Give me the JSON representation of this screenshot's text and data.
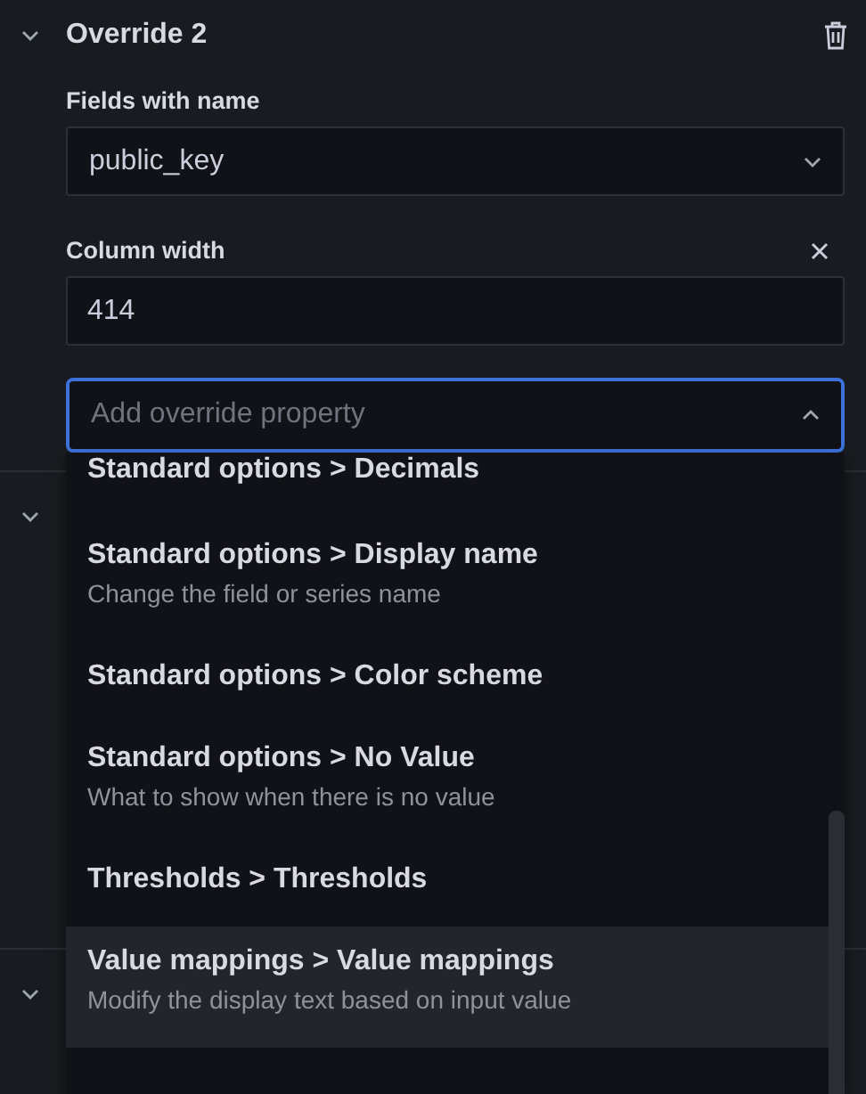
{
  "override": {
    "title": "Override 2",
    "expanded": true,
    "matcher": {
      "label": "Fields with name",
      "value": "public_key"
    },
    "properties": [
      {
        "label": "Column width",
        "value": "414"
      }
    ],
    "add_property": {
      "placeholder": "Add override property",
      "focused": true,
      "options": [
        {
          "label": "Standard options > Decimals",
          "selected": false
        },
        {
          "label": "Standard options > Display name",
          "description": "Change the field or series name",
          "selected": false
        },
        {
          "label": "Standard options > Color scheme",
          "selected": false
        },
        {
          "label": "Standard options > No Value",
          "description": "What to show when there is no value",
          "selected": false
        },
        {
          "label": "Thresholds > Thresholds",
          "selected": false
        },
        {
          "label": "Value mappings > Value mappings",
          "description": "Modify the display text based on input value",
          "selected": true
        }
      ]
    }
  },
  "collapsed_overrides": [
    {
      "expanded": true
    },
    {
      "expanded": true
    }
  ]
}
